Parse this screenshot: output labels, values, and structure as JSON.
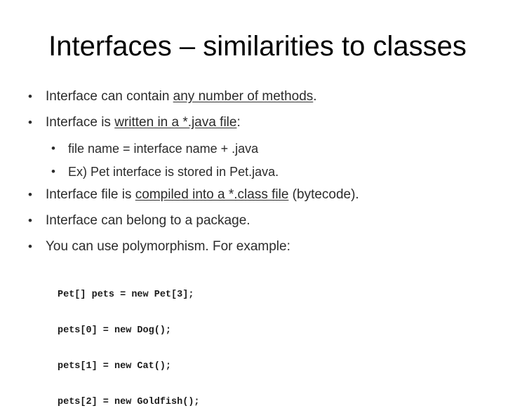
{
  "title": "Interfaces – similarities to classes",
  "bullet_symbol": "•",
  "bullets": [
    {
      "pre": "Interface can contain ",
      "link": "any number of methods",
      "post": "."
    },
    {
      "pre": "Interface is ",
      "link": "written in a *.java file",
      "post": ":"
    },
    {
      "text": "file name = interface name + .java"
    },
    {
      "text": "Ex) Pet interface is stored in Pet.java."
    },
    {
      "pre": "Interface file is ",
      "link": "compiled into a *.class file",
      "post": " (bytecode)."
    },
    {
      "text": "Interface can belong to a package."
    },
    {
      "text": "You can use polymorphism. For example:"
    }
  ],
  "code": [
    "Pet[] pets = new Pet[3];",
    "pets[0] = new Dog();",
    "pets[1] = new Cat();",
    "pets[2] = new Goldfish();"
  ]
}
